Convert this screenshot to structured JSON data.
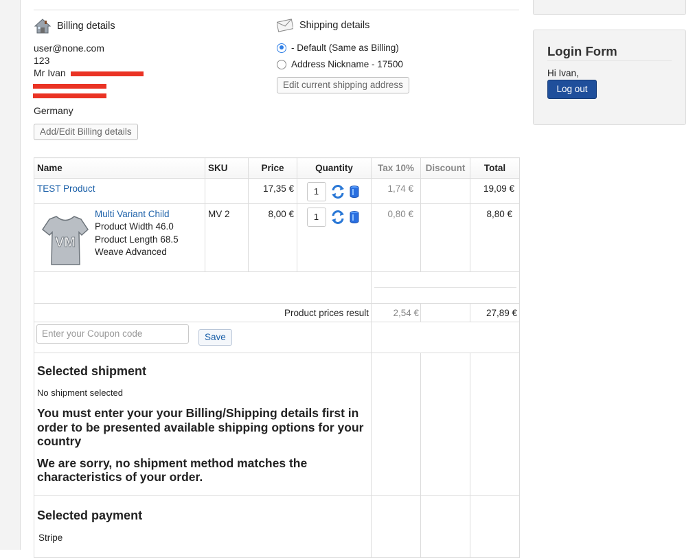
{
  "billing": {
    "title": "Billing details",
    "lines": [
      "user@none.com",
      "123",
      "Mr Ivan",
      "",
      "",
      "Germany"
    ],
    "edit_button": "Add/Edit Billing details"
  },
  "shipping": {
    "title": "Shipping details",
    "options": [
      {
        "label": "- Default (Same as Billing)",
        "checked": true
      },
      {
        "label": "Address Nickname - 17500",
        "checked": false
      }
    ],
    "edit_button": "Edit current shipping address"
  },
  "cart": {
    "headers": [
      "Name",
      "SKU",
      "Price",
      "Quantity",
      "Tax 10%",
      "Discount",
      "Total"
    ],
    "rows": [
      {
        "name": "TEST Product",
        "sku": "",
        "price": "17,35 €",
        "qty": "1",
        "tax": "1,74 €",
        "discount": "",
        "total": "19,09 €"
      },
      {
        "name": "Multi Variant Child",
        "details": [
          "Product Width 46.0",
          "Product Length 68.5",
          "Weave Advanced"
        ],
        "sku": "MV 2",
        "price": "8,00 €",
        "qty": "1",
        "tax": "0,80 €",
        "discount": "",
        "total": "8,80 €"
      }
    ],
    "summary": {
      "label": "Product prices result",
      "tax": "2,54 €",
      "total": "27,89 €"
    },
    "coupon": {
      "placeholder": "Enter your Coupon code",
      "save_label": "Save"
    },
    "shipment": {
      "title": "Selected shipment",
      "status": "No shipment selected",
      "warning1": "You must enter your your Billing/Shipping details first in order to be presented available shipping options for your country",
      "warning2": "We are sorry, no shipment method matches the characteristics of your order."
    },
    "payment": {
      "title": "Selected payment",
      "value": "Stripe"
    }
  },
  "sidebar": {
    "login": {
      "title": "Login Form",
      "greeting": "Hi Ivan,",
      "logout_label": "Log out"
    }
  },
  "colors": {
    "link": "#1a5fa8",
    "redaction": "#ea3324",
    "logout_bg": "#1f4f9b",
    "radio_accent": "#2f7fe6"
  }
}
